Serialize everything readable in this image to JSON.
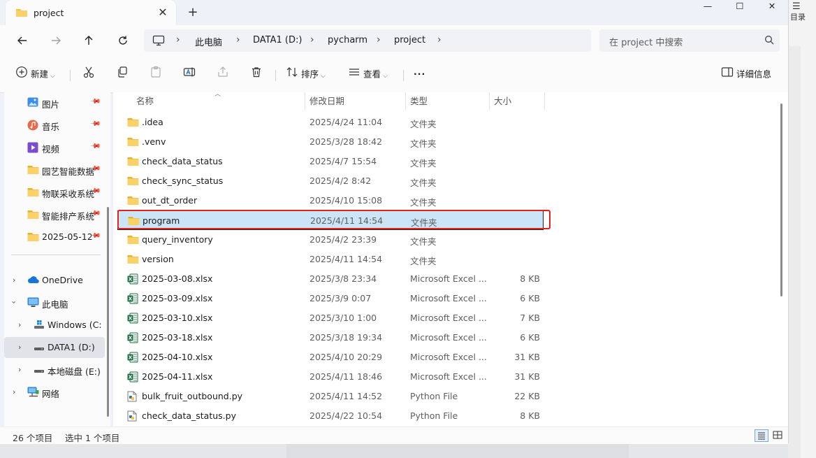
{
  "window": {
    "tab_title": "project",
    "new_tab": "+",
    "minimize": "—",
    "maximize": "☐",
    "close": "✕",
    "tab_close": "✕"
  },
  "address": {
    "breadcrumbs": [
      "此电脑",
      "DATA1 (D:)",
      "pycharm",
      "project"
    ],
    "separator": "›"
  },
  "search": {
    "placeholder": "在 project 中搜索"
  },
  "toolbar": {
    "new_label": "新建",
    "sort_label": "排序",
    "view_label": "查看",
    "more_label": "···",
    "details_label": "详细信息"
  },
  "sidebar": {
    "quick": [
      {
        "label": "图片",
        "icon": "pictures-icon"
      },
      {
        "label": "音乐",
        "icon": "music-icon"
      },
      {
        "label": "视频",
        "icon": "video-icon"
      },
      {
        "label": "园艺智能数据",
        "icon": "folder-icon"
      },
      {
        "label": "物联采收系统",
        "icon": "folder-icon"
      },
      {
        "label": "智能排产系统",
        "icon": "folder-icon"
      },
      {
        "label": "2025-05-12",
        "icon": "folder-icon"
      }
    ],
    "tree": [
      {
        "label": "OneDrive",
        "icon": "cloud-icon"
      },
      {
        "label": "此电脑",
        "icon": "computer-icon"
      },
      {
        "label": "Windows (C:)",
        "icon": "windows-drive-icon"
      },
      {
        "label": "DATA1 (D:)",
        "icon": "drive-icon"
      },
      {
        "label": "本地磁盘 (E:)",
        "icon": "drive-icon"
      },
      {
        "label": "网络",
        "icon": "network-icon"
      }
    ]
  },
  "columns": {
    "name": "名称",
    "date": "修改日期",
    "type": "类型",
    "size": "大小"
  },
  "files": [
    {
      "name": ".idea",
      "date": "2025/4/24 11:04",
      "type": "文件夹",
      "size": "",
      "kind": "folder"
    },
    {
      "name": ".venv",
      "date": "2025/3/28 18:42",
      "type": "文件夹",
      "size": "",
      "kind": "folder"
    },
    {
      "name": "check_data_status",
      "date": "2025/4/7 15:54",
      "type": "文件夹",
      "size": "",
      "kind": "folder"
    },
    {
      "name": "check_sync_status",
      "date": "2025/4/2 8:42",
      "type": "文件夹",
      "size": "",
      "kind": "folder"
    },
    {
      "name": "out_dt_order",
      "date": "2025/4/10 15:08",
      "type": "文件夹",
      "size": "",
      "kind": "folder"
    },
    {
      "name": "program",
      "date": "2025/4/11 14:54",
      "type": "文件夹",
      "size": "",
      "kind": "folder"
    },
    {
      "name": "query_inventory",
      "date": "2025/4/2 23:39",
      "type": "文件夹",
      "size": "",
      "kind": "folder"
    },
    {
      "name": "version",
      "date": "2025/4/11 14:54",
      "type": "文件夹",
      "size": "",
      "kind": "folder"
    },
    {
      "name": "2025-03-08.xlsx",
      "date": "2025/3/8 23:34",
      "type": "Microsoft Excel ...",
      "size": "8 KB",
      "kind": "excel"
    },
    {
      "name": "2025-03-09.xlsx",
      "date": "2025/3/9 0:07",
      "type": "Microsoft Excel ...",
      "size": "6 KB",
      "kind": "excel"
    },
    {
      "name": "2025-03-10.xlsx",
      "date": "2025/3/10 1:00",
      "type": "Microsoft Excel ...",
      "size": "7 KB",
      "kind": "excel"
    },
    {
      "name": "2025-03-18.xlsx",
      "date": "2025/3/18 19:34",
      "type": "Microsoft Excel ...",
      "size": "6 KB",
      "kind": "excel"
    },
    {
      "name": "2025-04-10.xlsx",
      "date": "2025/4/10 20:29",
      "type": "Microsoft Excel ...",
      "size": "31 KB",
      "kind": "excel"
    },
    {
      "name": "2025-04-11.xlsx",
      "date": "2025/4/11 18:46",
      "type": "Microsoft Excel ...",
      "size": "31 KB",
      "kind": "excel"
    },
    {
      "name": "bulk_fruit_outbound.py",
      "date": "2025/4/11 14:52",
      "type": "Python File",
      "size": "22 KB",
      "kind": "python"
    },
    {
      "name": "check_data_status.py",
      "date": "2025/4/22 10:54",
      "type": "Python File",
      "size": "8 KB",
      "kind": "python"
    }
  ],
  "selected_index": 5,
  "status": {
    "count": "26 个项目",
    "selection": "选中 1 个项目"
  },
  "background": {
    "right_icon": "☰",
    "right_label": "目录"
  },
  "colors": {
    "accent": "#0067c0",
    "selection": "#cce4f7",
    "folder": "#f5c443",
    "excel": "#1d6f42",
    "highlight": "#e2231a"
  }
}
